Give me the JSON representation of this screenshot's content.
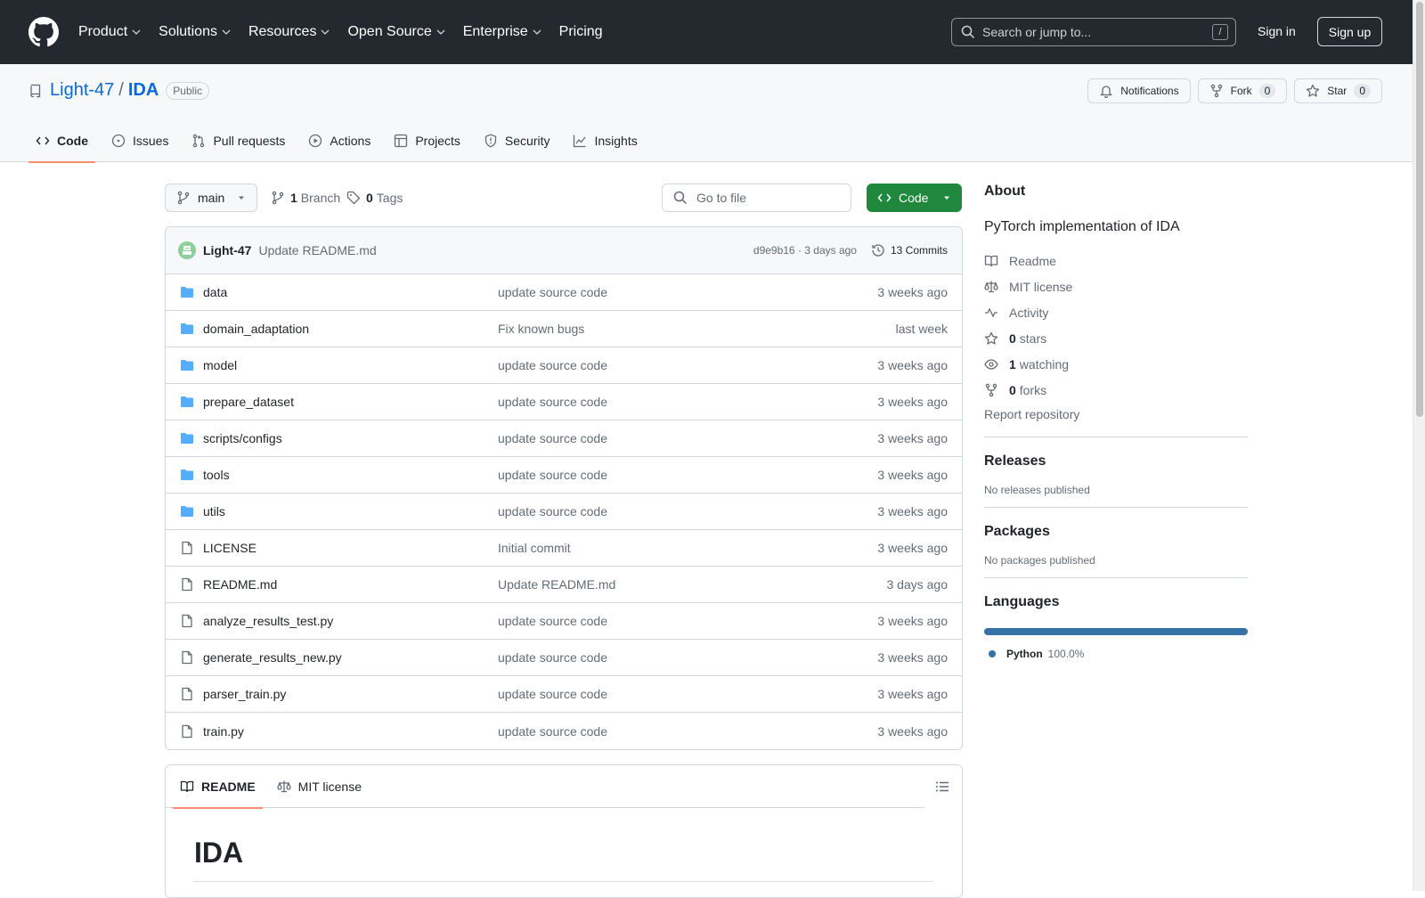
{
  "header": {
    "nav": [
      "Product",
      "Solutions",
      "Resources",
      "Open Source",
      "Enterprise",
      "Pricing"
    ],
    "search_placeholder": "Search or jump to...",
    "search_shortcut": "/",
    "signin": "Sign in",
    "signup": "Sign up"
  },
  "repo": {
    "owner": "Light-47",
    "separator": "/",
    "name": "IDA",
    "visibility": "Public",
    "notifications": "Notifications",
    "fork_label": "Fork",
    "fork_count": "0",
    "star_label": "Star",
    "star_count": "0",
    "tabs": [
      "Code",
      "Issues",
      "Pull requests",
      "Actions",
      "Projects",
      "Security",
      "Insights"
    ]
  },
  "toolbar": {
    "branch": "main",
    "branch_count": "1",
    "branch_label": "Branch",
    "tag_count": "0",
    "tag_label": "Tags",
    "goto_placeholder": "Go to file",
    "code_label": "Code"
  },
  "commit": {
    "author": "Light-47",
    "message": "Update README.md",
    "meta": "d9e9b16 · 3 days ago",
    "commits": "13 Commits"
  },
  "files": [
    {
      "name": "data",
      "type": "dir",
      "message": "update source code",
      "date": "3 weeks ago"
    },
    {
      "name": "domain_adaptation",
      "type": "dir",
      "message": "Fix known bugs",
      "date": "last week"
    },
    {
      "name": "model",
      "type": "dir",
      "message": "update source code",
      "date": "3 weeks ago"
    },
    {
      "name": "prepare_dataset",
      "type": "dir",
      "message": "update source code",
      "date": "3 weeks ago"
    },
    {
      "name": "scripts/configs",
      "type": "dir",
      "message": "update source code",
      "date": "3 weeks ago"
    },
    {
      "name": "tools",
      "type": "dir",
      "message": "update source code",
      "date": "3 weeks ago"
    },
    {
      "name": "utils",
      "type": "dir",
      "message": "update source code",
      "date": "3 weeks ago"
    },
    {
      "name": "LICENSE",
      "type": "file",
      "message": "Initial commit",
      "date": "3 weeks ago"
    },
    {
      "name": "README.md",
      "type": "file",
      "message": "Update README.md",
      "date": "3 days ago"
    },
    {
      "name": "analyze_results_test.py",
      "type": "file",
      "message": "update source code",
      "date": "3 weeks ago"
    },
    {
      "name": "generate_results_new.py",
      "type": "file",
      "message": "update source code",
      "date": "3 weeks ago"
    },
    {
      "name": "parser_train.py",
      "type": "file",
      "message": "update source code",
      "date": "3 weeks ago"
    },
    {
      "name": "train.py",
      "type": "file",
      "message": "update source code",
      "date": "3 weeks ago"
    }
  ],
  "readme": {
    "tab_readme": "README",
    "tab_license": "MIT license",
    "heading": "IDA"
  },
  "about": {
    "title": "About",
    "description": "PyTorch implementation of IDA",
    "readme": "Readme",
    "license": "MIT license",
    "activity": "Activity",
    "stars_count": "0",
    "stars_label": "stars",
    "watching_count": "1",
    "watching_label": "watching",
    "forks_count": "0",
    "forks_label": "forks",
    "report": "Report repository"
  },
  "releases": {
    "title": "Releases",
    "empty": "No releases published"
  },
  "packages": {
    "title": "Packages",
    "empty": "No packages published"
  },
  "languages": {
    "title": "Languages",
    "items": [
      {
        "name": "Python",
        "percent": "100.0%",
        "color": "#3572A5"
      }
    ]
  }
}
